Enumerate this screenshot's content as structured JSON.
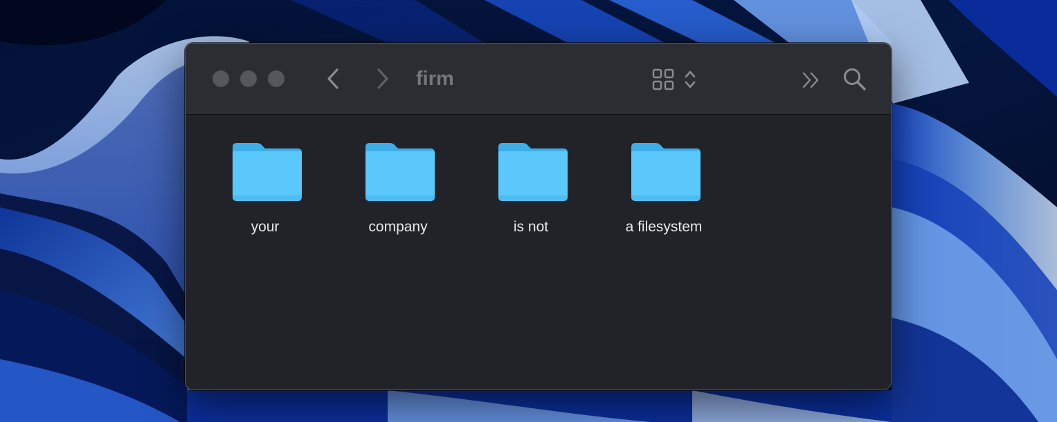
{
  "window": {
    "title": "firm"
  },
  "folders": [
    {
      "name": "your"
    },
    {
      "name": "company"
    },
    {
      "name": "is not"
    },
    {
      "name": "a filesystem"
    }
  ],
  "colors": {
    "folder_body": "#5ac8fb",
    "folder_tab": "#3eaee8",
    "window_bg": "#212328",
    "toolbar_bg": "#2b2d32"
  },
  "icons": {
    "toolbar": [
      "chevron-left-icon",
      "chevron-right-icon",
      "grid-view-icon",
      "up-down-chevron-icon",
      "double-chevron-right-icon",
      "search-icon"
    ]
  }
}
